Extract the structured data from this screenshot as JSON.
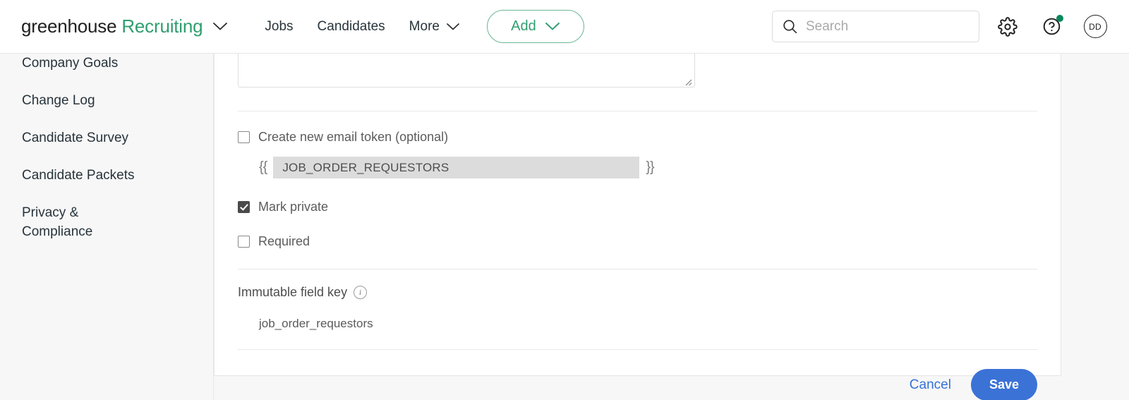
{
  "header": {
    "brand_name": "greenhouse",
    "brand_product": "Recruiting",
    "brand_caret_icon": "chevron-down-icon",
    "nav_links": [
      {
        "label": "Jobs",
        "caret": false
      },
      {
        "label": "Candidates",
        "caret": false
      },
      {
        "label": "More",
        "caret": true
      }
    ],
    "add_button": {
      "label": "Add",
      "caret_icon": "chevron-down-icon"
    },
    "search": {
      "placeholder": "Search",
      "value": "",
      "icon": "search-icon"
    },
    "settings_icon": "gear-icon",
    "help_icon": "question-circle-icon",
    "help_badge_color": "#07875a",
    "avatar_initials": "DD"
  },
  "sidebar": {
    "items": [
      {
        "label": "Company Goals"
      },
      {
        "label": "Change Log"
      },
      {
        "label": "Candidate Survey"
      },
      {
        "label": "Candidate Packets"
      },
      {
        "label": "Privacy & Compliance"
      }
    ]
  },
  "form": {
    "description_textarea": {
      "value": "",
      "resize_handle_icon": "resize-grip-icon"
    },
    "email_token_checkbox": {
      "label": "Create new email token (optional)",
      "checked": false
    },
    "token": {
      "open_brace": "{{",
      "close_brace": "}}",
      "value": "JOB_ORDER_REQUESTORS"
    },
    "mark_private_checkbox": {
      "label": "Mark private",
      "checked": true
    },
    "required_checkbox": {
      "label": "Required",
      "checked": false
    },
    "immutable_field_key": {
      "label": "Immutable field key",
      "info_icon": "info-circle-icon",
      "value": "job_order_requestors"
    },
    "cancel_label": "Cancel",
    "save_label": "Save"
  },
  "colors": {
    "brand_green": "#2f9e6e",
    "primary_blue": "#3b72d6",
    "link_blue": "#3471d8",
    "checkbox_checked": "#4a4a4a",
    "token_field_bg": "#dcdcdc"
  }
}
